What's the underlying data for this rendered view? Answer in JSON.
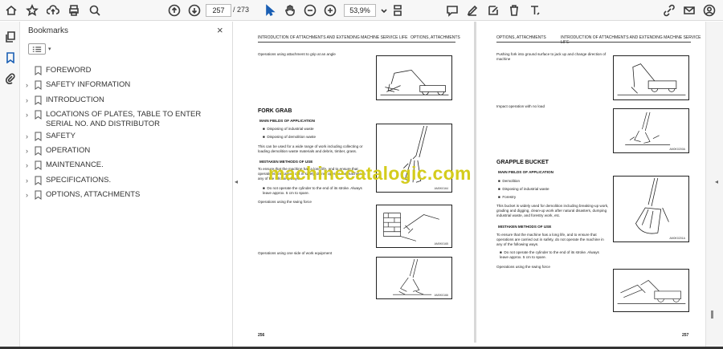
{
  "toolbar": {
    "page_current": "257",
    "page_total": "/ 273",
    "zoom": "53,9%"
  },
  "sidebar": {
    "title": "Bookmarks",
    "close": "×",
    "items": [
      {
        "label": "FOREWORD",
        "expandable": false
      },
      {
        "label": "SAFETY INFORMATION",
        "expandable": true
      },
      {
        "label": "INTRODUCTION",
        "expandable": true
      },
      {
        "label": "LOCATIONS OF PLATES, TABLE TO ENTER SERIAL NO. AND DISTRIBUTOR",
        "expandable": true
      },
      {
        "label": "SAFETY",
        "expandable": true
      },
      {
        "label": "OPERATION",
        "expandable": true
      },
      {
        "label": "MAINTENANCE.",
        "expandable": true
      },
      {
        "label": "SPECIFICATIONS.",
        "expandable": true
      },
      {
        "label": "OPTIONS, ATTACHMENTS",
        "expandable": true
      }
    ]
  },
  "left_page": {
    "header_left": "INTRODUCTION OF ATTACHMENTS AND EXTENDING MACHINE SERVICE LIFE",
    "header_right": "OPTIONS, ATTACHMENTS",
    "t1": "Operations using attachment to grip at an angle",
    "h_fork": "FORK GRAB",
    "h_main": "MAIN FIELDS OF APPLICATION",
    "b1": "Disposing of industrial waste",
    "b2": "Disposing of demolition waste",
    "p1": "This can be used for a wide range of work including collecting or loading demolition waste materials and debris, timber, grass.",
    "h_mistake": "MISTAKEN METHODS OF USE",
    "p2": "To ensure that the machine has a long life, and to ensure that operations are carried out in safety, do not operate the machine in any of the following ways.",
    "b3": "Do not operate the cylinder to the end of its stroke. Always leave approx. 5 cm to spare.",
    "t2": "Operations using the swing force",
    "t3": "Operations using one side of work equipment",
    "cap1": "AM0K0164",
    "cap2": "AM0K0165",
    "cap3": "AM0K0166",
    "page_number": "256"
  },
  "right_page": {
    "header_left": "OPTIONS, ATTACHMENTS",
    "header_right": "INTRODUCTION OF ATTACHMENTS AND EXTENDING MACHINE SERVICE LIFE",
    "t1": "Pushing fork into ground surface to jack up and change direction of machine",
    "t2": "Impact operation with no load",
    "h_grapple": "GRAPPLE BUCKET",
    "h_main": "MAIN FIELDS OF APPLICATION",
    "b1": "Demolition",
    "b2": "Disposing of industrial waste",
    "b3": "Forestry",
    "p1": "This bucket is widely used for demolition including breaking-up work, grading and digging, clean-up work after natural disasters, dumping industrial waste, and forestry work, etc.",
    "h_mistake": "MISTAKEN METHODS OF USE",
    "p2": "To ensure that the machine has a long life, and to ensure that operations are carried out in safety, do not operate the machine in any of the following ways.",
    "b4": "Do not operate the cylinder to the end of its stroke. Always leave approx. 5 cm to spare.",
    "t3": "Operations using the swing force",
    "cap1": "AM0K0200A",
    "cap2": "AM0K0201A",
    "page_number": "257"
  },
  "watermark": "machinecatalogic.com",
  "colors": {
    "watermark": "#d4cc1c",
    "toolbar_bg": "#f7f7f7",
    "accent_blue": "#1a5fb4"
  }
}
